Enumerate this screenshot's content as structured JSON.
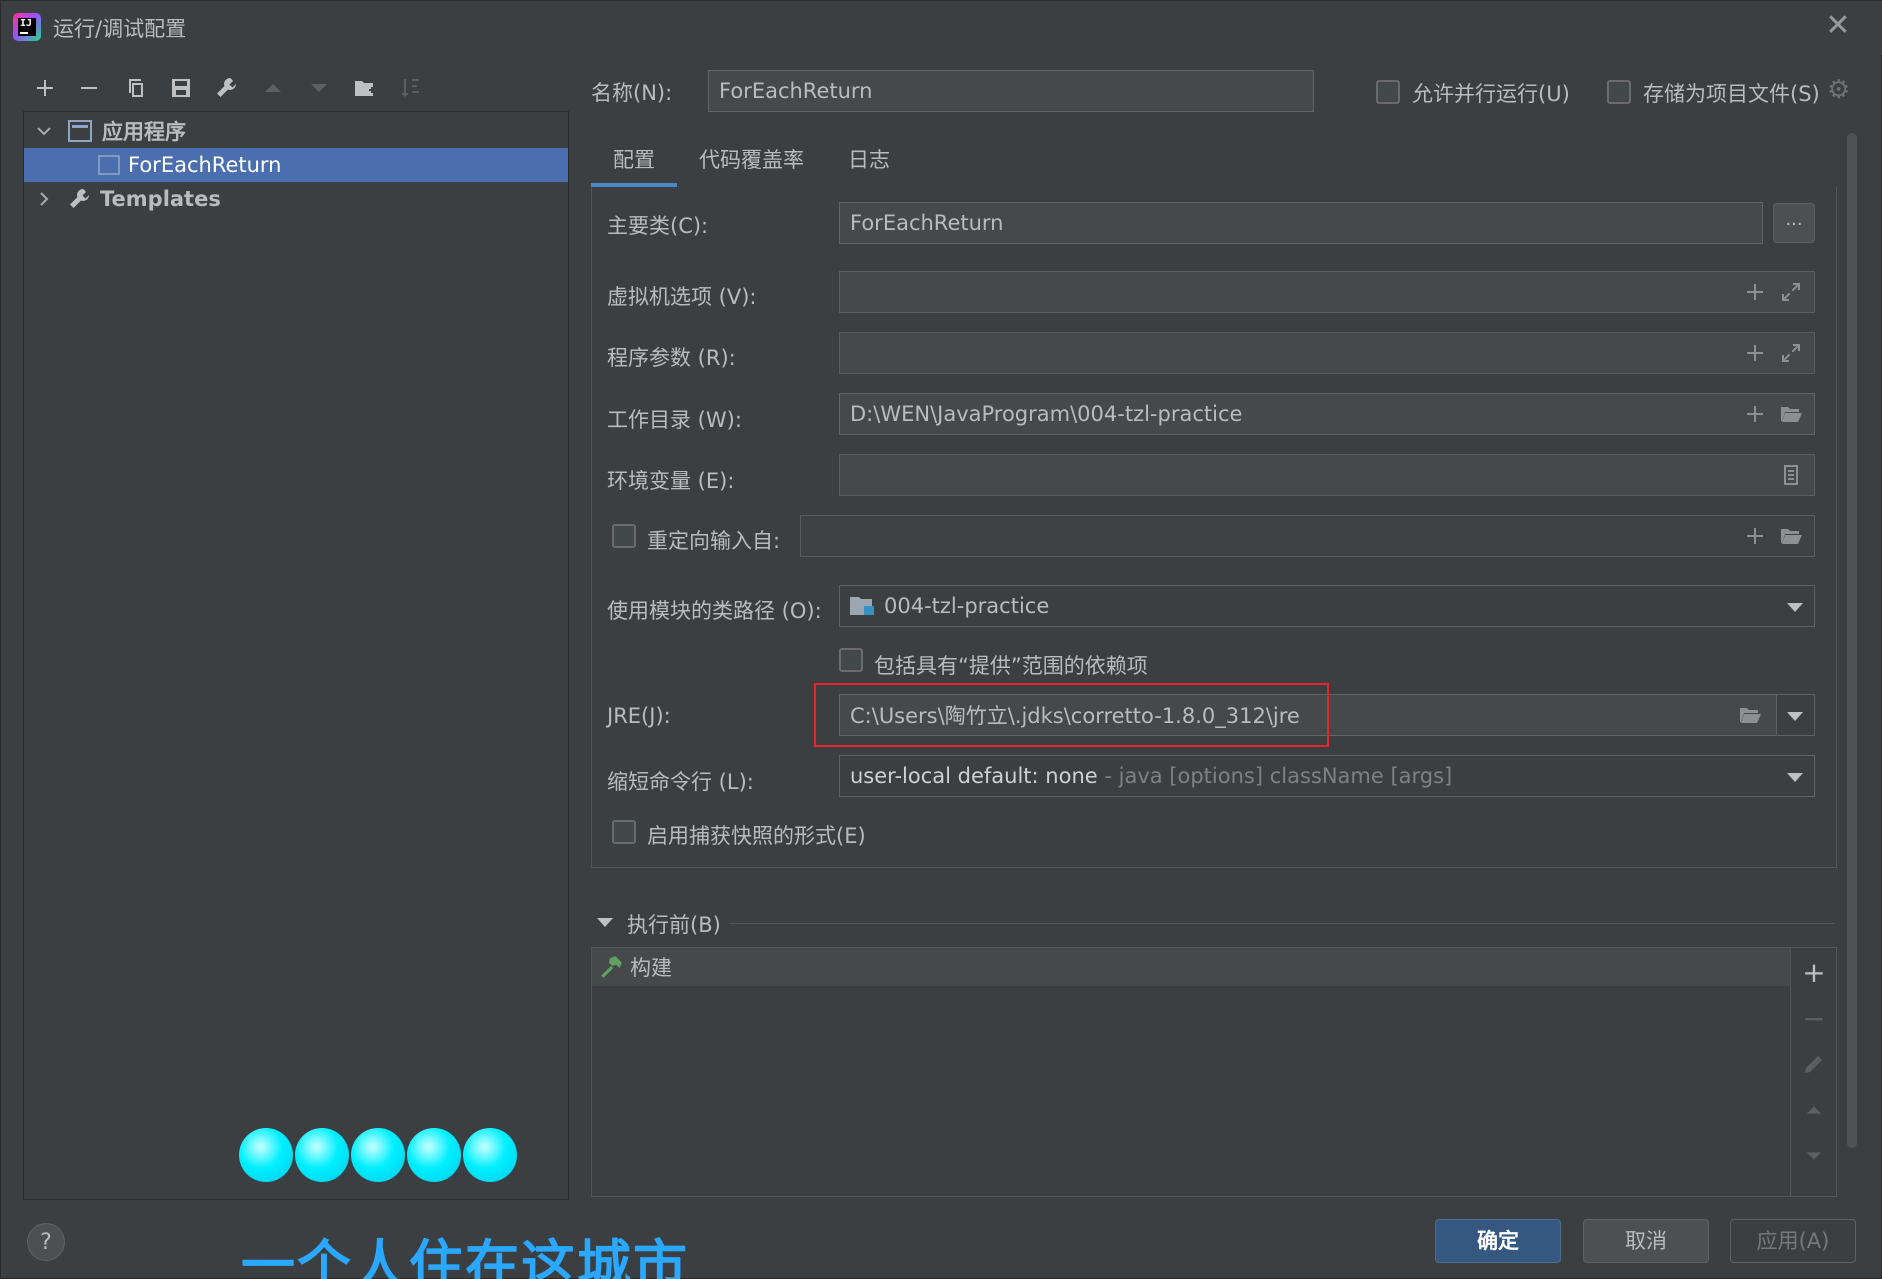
{
  "window": {
    "title": "运行/调试配置"
  },
  "tree": {
    "group_label": "应用程序",
    "selected_item": "ForEachReturn",
    "templates_label": "Templates"
  },
  "header": {
    "name_label": "名称(N):",
    "name_value": "ForEachReturn",
    "allow_parallel_label": "允许并行运行(U)",
    "store_as_project_label": "存储为项目文件(S)"
  },
  "tabs": [
    "配置",
    "代码覆盖率",
    "日志"
  ],
  "form": {
    "main_class_label": "主要类(C):",
    "main_class_value": "ForEachReturn",
    "main_class_browse": "...",
    "vm_options_label": "虚拟机选项 (V):",
    "program_args_label": "程序参数 (R):",
    "working_dir_label": "工作目录 (W):",
    "working_dir_value": "D:\\WEN\\JavaProgram\\004-tzl-practice",
    "env_vars_label": "环境变量 (E):",
    "redirect_input_label": "重定向输入自:",
    "module_classpath_label": "使用模块的类路径 (O):",
    "module_classpath_value": "004-tzl-practice",
    "include_provided_label": "包括具有“提供”范围的依赖项",
    "jre_label": "JRE(J):",
    "jre_value": "C:\\Users\\陶竹立\\.jdks\\corretto-1.8.0_312\\jre",
    "shorten_cmd_label": "缩短命令行 (L):",
    "shorten_cmd_value": "user-local default: none",
    "shorten_cmd_hint": " - java [options] className [args]",
    "snapshot_label": "启用捕获快照的形式(E)"
  },
  "before_launch": {
    "title": "执行前(B)",
    "items": [
      "构建"
    ]
  },
  "overlay": {
    "caption": "一个人住在这城市",
    "ball_count": 5
  },
  "buttons": {
    "help": "?",
    "ok": "确定",
    "cancel": "取消",
    "apply": "应用(A)"
  },
  "colors": {
    "selection": "#4b6eaf",
    "primary_button": "#365880",
    "highlight_box": "#e8252a",
    "caption": "#2aa7ff"
  }
}
